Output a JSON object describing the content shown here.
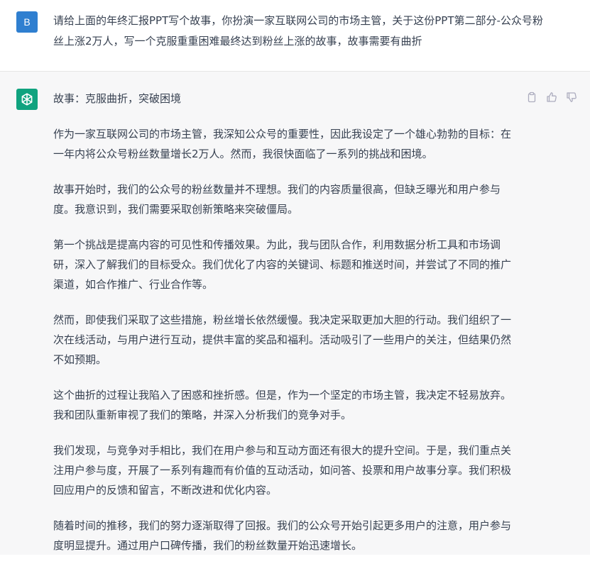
{
  "user": {
    "avatar_letter": "B",
    "message": "请给上面的年终汇报PPT写个故事，你扮演一家互联网公司的市场主管，关于这份PPT第二部分-公众号粉丝上涨2万人，写一个克服重重困难最终达到粉丝上涨的故事，故事需要有曲折"
  },
  "assistant": {
    "title": "故事：克服曲折，突破困境",
    "paragraphs": [
      "作为一家互联网公司的市场主管，我深知公众号的重要性，因此我设定了一个雄心勃勃的目标：在一年内将公众号粉丝数量增长2万人。然而，我很快面临了一系列的挑战和困境。",
      "故事开始时，我们的公众号的粉丝数量并不理想。我们的内容质量很高，但缺乏曝光和用户参与度。我意识到，我们需要采取创新策略来突破僵局。",
      "第一个挑战是提高内容的可见性和传播效果。为此，我与团队合作，利用数据分析工具和市场调研，深入了解我们的目标受众。我们优化了内容的关键词、标题和推送时间，并尝试了不同的推广渠道，如合作推广、行业合作等。",
      "然而，即使我们采取了这些措施，粉丝增长依然缓慢。我决定采取更加大胆的行动。我们组织了一次在线活动，与用户进行互动，提供丰富的奖品和福利。活动吸引了一些用户的关注，但结果仍然不如预期。",
      "这个曲折的过程让我陷入了困惑和挫折感。但是，作为一个坚定的市场主管，我决定不轻易放弃。我和团队重新审视了我们的策略，并深入分析我们的竞争对手。",
      "我们发现，与竞争对手相比，我们在用户参与和互动方面还有很大的提升空间。于是，我们重点关注用户参与度，开展了一系列有趣而有价值的互动活动，如问答、投票和用户故事分享。我们积极回应用户的反馈和留言，不断改进和优化内容。",
      "随着时间的推移，我们的努力逐渐取得了回报。我们的公众号开始引起更多用户的注意，用户参与度明显提升。通过用户口碑传播，我们的粉丝数量开始迅速增长。"
    ],
    "avatar_icon": "openai-logo-icon"
  },
  "actions": [
    {
      "icon": "copy-icon"
    },
    {
      "icon": "thumbs-up-icon"
    },
    {
      "icon": "thumbs-down-icon"
    }
  ],
  "colors": {
    "user_avatar": "#2f7fd0",
    "bot_avatar": "#10a37f",
    "assistant_bg": "#f7f7f8",
    "text": "#374151"
  }
}
